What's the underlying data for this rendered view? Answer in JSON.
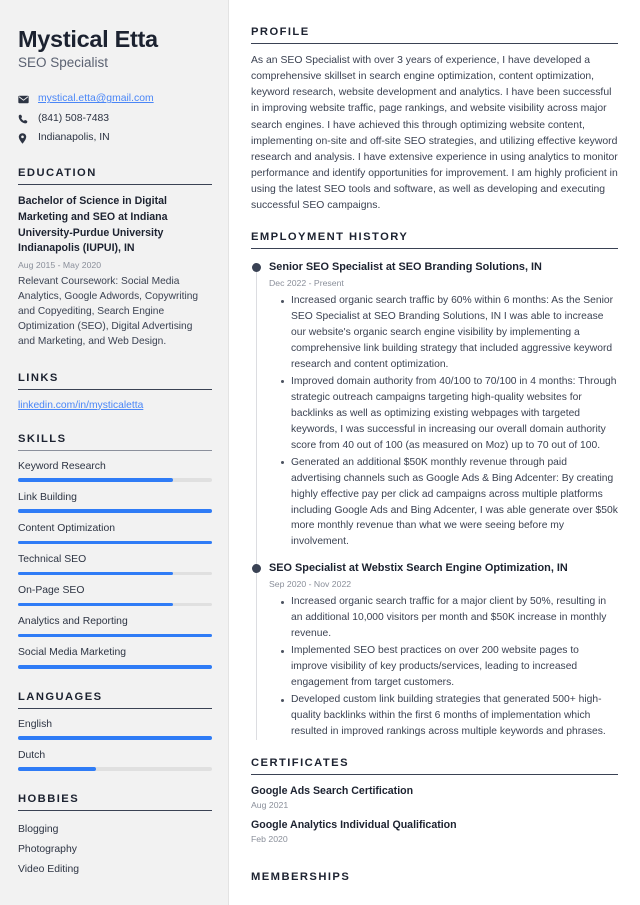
{
  "sidebar": {
    "name": "Mystical Etta",
    "job_title": "SEO Specialist",
    "contact": [
      {
        "icon": "envelope-icon",
        "text": "mystical.etta@gmail.com",
        "is_link": true
      },
      {
        "icon": "phone-icon",
        "text": "(841) 508-7483",
        "is_link": false
      },
      {
        "icon": "location-pin-icon",
        "text": "Indianapolis, IN",
        "is_link": false
      }
    ],
    "education": {
      "heading": "EDUCATION",
      "degree": "Bachelor of Science in Digital Marketing and SEO at Indiana University-Purdue University Indianapolis (IUPUI), IN",
      "date": "Aug 2015 - May 2020",
      "description": "Relevant Coursework: Social Media Analytics, Google Adwords, Copywriting and Copyediting, Search Engine Optimization (SEO), Digital Advertising and Marketing, and Web Design."
    },
    "links": {
      "heading": "LINKS",
      "items": [
        {
          "label": "linkedin.com/in/mysticaletta"
        }
      ]
    },
    "skills": {
      "heading": "SKILLS",
      "items": [
        {
          "label": "Keyword Research",
          "level": 80
        },
        {
          "label": "Link Building",
          "level": 100
        },
        {
          "label": "Content Optimization",
          "level": 100
        },
        {
          "label": "Technical SEO",
          "level": 80
        },
        {
          "label": "On-Page SEO",
          "level": 80
        },
        {
          "label": "Analytics and Reporting",
          "level": 100
        },
        {
          "label": "Social Media Marketing",
          "level": 100
        }
      ]
    },
    "languages": {
      "heading": "LANGUAGES",
      "items": [
        {
          "label": "English",
          "level": 100
        },
        {
          "label": "Dutch",
          "level": 40
        }
      ]
    },
    "hobbies": {
      "heading": "HOBBIES",
      "items": [
        {
          "label": "Blogging"
        },
        {
          "label": "Photography"
        },
        {
          "label": "Video Editing"
        }
      ]
    }
  },
  "main": {
    "profile": {
      "heading": "PROFILE",
      "text": "As an SEO Specialist with over 3 years of experience, I have developed a comprehensive skillset in search engine optimization, content optimization, keyword research, website development and analytics. I have been successful in improving website traffic, page rankings, and website visibility across major search engines. I have achieved this through optimizing website content, implementing on-site and off-site SEO strategies, and utilizing effective keyword research and analysis. I have extensive experience in using analytics to monitor performance and identify opportunities for improvement. I am highly proficient in using the latest SEO tools and software, as well as developing and executing successful SEO campaigns."
    },
    "employment": {
      "heading": "EMPLOYMENT HISTORY",
      "jobs": [
        {
          "title": "Senior SEO Specialist at SEO Branding Solutions, IN",
          "date": "Dec 2022 - Present",
          "bullets": [
            "Increased organic search traffic by 60% within 6 months: As the Senior SEO Specialist at SEO Branding Solutions, IN I was able to increase our website's organic search engine visibility by implementing a comprehensive link building strategy that included aggressive keyword research and content optimization.",
            "Improved domain authority from 40/100 to 70/100 in 4 months: Through strategic outreach campaigns targeting high-quality websites for backlinks as well as optimizing existing webpages with targeted keywords, I was successful in increasing our overall domain authority score from 40 out of 100 (as measured on Moz) up to 70 out of 100.",
            "Generated an additional $50K monthly revenue through paid advertising channels such as Google Ads & Bing Adcenter: By creating highly effective pay per click ad campaigns across multiple platforms including Google Ads and Bing Adcenter, I was able generate over $50k more monthly revenue than what we were seeing before my involvement."
          ]
        },
        {
          "title": "SEO Specialist at Webstix Search Engine Optimization, IN",
          "date": "Sep 2020 - Nov 2022",
          "bullets": [
            "Increased organic search traffic for a major client by 50%, resulting in an additional 10,000 visitors per month and $50K increase in monthly revenue.",
            "Implemented SEO best practices on over 200 website pages to improve visibility of key products/services, leading to increased engagement from target customers.",
            "Developed custom link building strategies that generated 500+ high-quality backlinks within the first 6 months of implementation which resulted in improved rankings across multiple keywords and phrases."
          ]
        }
      ]
    },
    "certificates": {
      "heading": "CERTIFICATES",
      "items": [
        {
          "name": "Google Ads Search Certification",
          "date": "Aug 2021"
        },
        {
          "name": "Google Analytics Individual Qualification",
          "date": "Feb 2020"
        }
      ]
    },
    "memberships": {
      "heading": "MEMBERSHIPS"
    }
  },
  "colors": {
    "accent_blue": "#2f7cf6",
    "link_blue": "#4a86f7",
    "heading_dark": "#1c2230",
    "sidebar_bg": "#f2f2f2",
    "muted_text": "#8a8f9a"
  }
}
